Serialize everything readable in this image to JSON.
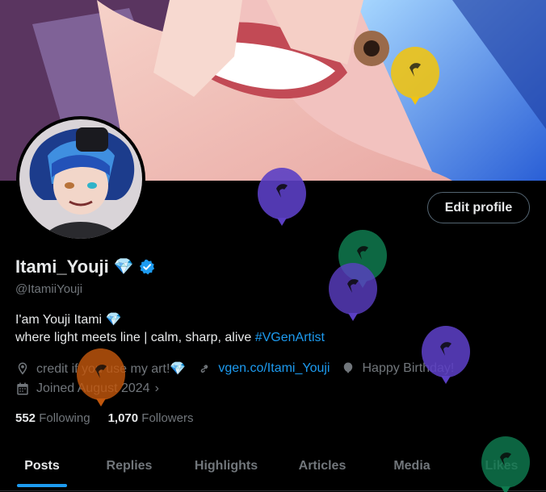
{
  "profile": {
    "display_name": "Itami_Youji",
    "name_emoji": "💎",
    "handle": "@ItamiiYouji",
    "edit_button": "Edit profile"
  },
  "bio": {
    "line1": "I'am Youji Itami 💎",
    "line2_text": "where light meets line | calm, sharp, alive ",
    "hashtag": "#VGenArtist"
  },
  "meta": {
    "location": "credit if you use my art!💎",
    "website": "vgen.co/Itami_Youji",
    "birthday": "Happy Birthday!",
    "joined": "Joined August 2024"
  },
  "stats": {
    "following_count": "552",
    "following_label": "Following",
    "followers_count": "1,070",
    "followers_label": "Followers"
  },
  "tabs": [
    {
      "label": "Posts",
      "active": true
    },
    {
      "label": "Replies",
      "active": false
    },
    {
      "label": "Highlights",
      "active": false
    },
    {
      "label": "Articles",
      "active": false
    },
    {
      "label": "Media",
      "active": false
    },
    {
      "label": "Likes",
      "active": false
    }
  ],
  "icons": {
    "location": "location-pin-icon",
    "link": "link-icon",
    "birthday": "balloon-icon",
    "calendar": "calendar-icon",
    "verified": "verified-badge-icon"
  },
  "colors": {
    "accent": "#1d9bf0",
    "muted": "#71767b",
    "text": "#e7e9ea",
    "balloon_purple": "#5b3fc4",
    "balloon_green": "#0f7a4f",
    "balloon_yellow": "#f1c40f",
    "balloon_orange": "#c2570c"
  }
}
